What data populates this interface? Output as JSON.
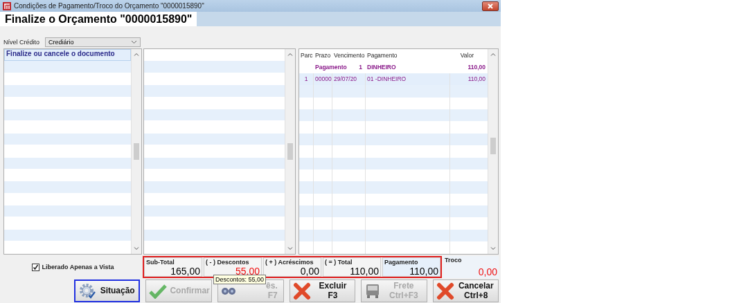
{
  "window": {
    "title": "Condições de Pagamento/Troco do Orçamento \"0000015890\""
  },
  "header": {
    "title": "Finalize o Orçamento \"0000015890\""
  },
  "credit_level": {
    "label": "Nível Crédito",
    "value": "Crediário"
  },
  "message_list": {
    "items": [
      {
        "text": "Finalize ou cancele o documento",
        "selected": true
      }
    ]
  },
  "payments": {
    "columns": [
      "Parc",
      "Prazo",
      "Vencimento",
      "Pagamento",
      "Valor"
    ],
    "rows": [
      {
        "kind": "group",
        "label": "Pagamento",
        "number": "1",
        "payment": "DINHEIRO",
        "value": "110,00",
        "selected": false
      },
      {
        "kind": "detail",
        "parc": "1",
        "prazo": "00000",
        "vencimento": "29/07/20",
        "pagamento": "01 -DINHEIRO",
        "valor": "110,00",
        "selected": true
      }
    ]
  },
  "checkbox": {
    "label": "Liberado Apenas a Vista",
    "checked": true
  },
  "totals": [
    {
      "label": "Sub-Total",
      "value": "165,00",
      "alert": false,
      "highlighted": false
    },
    {
      "label": "( - ) Descontos",
      "value": "55,00",
      "alert": true,
      "highlighted": false
    },
    {
      "label": "( + ) Acréscimos",
      "value": "0,00",
      "alert": false,
      "highlighted": false
    },
    {
      "label": "( = ) Total",
      "value": "110,00",
      "alert": false,
      "highlighted": false
    },
    {
      "label": "Pagamento",
      "value": "110,00",
      "alert": false,
      "highlighted": true
    }
  ],
  "change": {
    "label": "Troco",
    "value": "0,00",
    "alert": true
  },
  "buttons": [
    {
      "kind": "status",
      "label": "Situação",
      "disabled": false,
      "focused": true
    },
    {
      "kind": "confirm",
      "label": "Confirmar",
      "disabled": true,
      "focused": false
    },
    {
      "kind": "notes",
      "label": "ês.",
      "shortcut": "F7",
      "disabled": true,
      "focused": false
    },
    {
      "kind": "delete",
      "label": "Excluir",
      "shortcut": "F3",
      "disabled": false,
      "focused": false
    },
    {
      "kind": "freight",
      "label": "Frete",
      "shortcut": "Ctrl+F3",
      "disabled": true,
      "focused": false
    },
    {
      "kind": "cancel",
      "label": "Cancelar",
      "shortcut": "Ctrl+8",
      "disabled": false,
      "focused": false
    }
  ],
  "tooltip": {
    "text": "Descontos: 55,00"
  }
}
